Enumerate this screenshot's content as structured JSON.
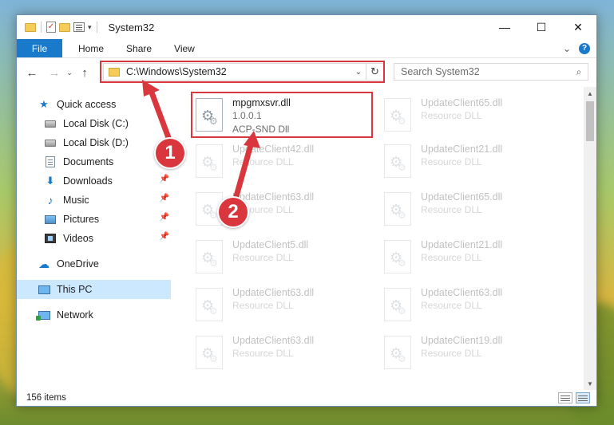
{
  "window": {
    "title": "System32",
    "controls": {
      "minimize": "—",
      "maximize": "☐",
      "close": "✕"
    }
  },
  "ribbon": {
    "file_tab": "File",
    "tabs": [
      "Home",
      "Share",
      "View"
    ],
    "expand_caret": "⌄",
    "help": "?"
  },
  "nav": {
    "back": "←",
    "forward": "→",
    "recent": "⌄",
    "up": "↑",
    "address": "C:\\Windows\\System32",
    "address_drop": "⌄",
    "refresh": "↻",
    "search_placeholder": "Search System32",
    "search_icon": "⌕"
  },
  "sidebar": {
    "quick_access": "Quick access",
    "items": [
      {
        "label": "Local Disk (C:)",
        "icon": "drive-icon",
        "pinned": false
      },
      {
        "label": "Local Disk (D:)",
        "icon": "drive-icon",
        "pinned": false
      },
      {
        "label": "Documents",
        "icon": "documents-icon",
        "pinned": true
      },
      {
        "label": "Downloads",
        "icon": "downloads-icon",
        "pinned": true
      },
      {
        "label": "Music",
        "icon": "music-icon",
        "pinned": true
      },
      {
        "label": "Pictures",
        "icon": "pictures-icon",
        "pinned": true
      },
      {
        "label": "Videos",
        "icon": "videos-icon",
        "pinned": true
      }
    ],
    "onedrive": "OneDrive",
    "this_pc": "This PC",
    "network": "Network",
    "pin_glyph": "📌"
  },
  "files": [
    {
      "name": "mpgmxsvr.dll",
      "version": "1.0.0.1",
      "desc": "ACP-SND Dll",
      "faded": false
    },
    {
      "name": "UpdateClient65.dll",
      "desc": "Resource DLL",
      "faded": true
    },
    {
      "name": "UpdateClient42.dll",
      "desc": "Resource DLL",
      "faded": true
    },
    {
      "name": "UpdateClient21.dll",
      "desc": "Resource DLL",
      "faded": true
    },
    {
      "name": "UpdateClient63.dll",
      "desc": "Resource DLL",
      "faded": true
    },
    {
      "name": "UpdateClient65.dll",
      "desc": "Resource DLL",
      "faded": true
    },
    {
      "name": "UpdateClient5.dll",
      "desc": "Resource DLL",
      "faded": true
    },
    {
      "name": "UpdateClient21.dll",
      "desc": "Resource DLL",
      "faded": true
    },
    {
      "name": "UpdateClient63.dll",
      "desc": "Resource DLL",
      "faded": true
    },
    {
      "name": "UpdateClient63.dll",
      "desc": "Resource DLL",
      "faded": true
    },
    {
      "name": "UpdateClient63.dll",
      "desc": "Resource DLL",
      "faded": true
    },
    {
      "name": "UpdateClient19.dll",
      "desc": "Resource DLL",
      "faded": true
    }
  ],
  "annotations": {
    "step1": "1",
    "step2": "2",
    "color": "#d9363e"
  },
  "status": {
    "item_count": "156 items"
  },
  "colors": {
    "accent": "#1979ca",
    "selection": "#cce8ff"
  }
}
